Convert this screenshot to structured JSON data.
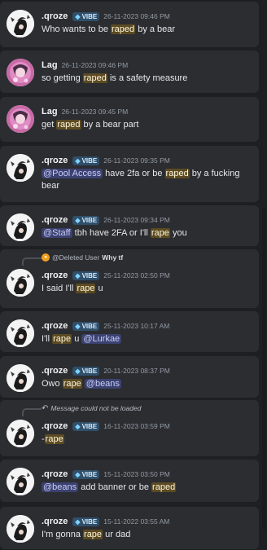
{
  "results": [
    {
      "user": "qroze",
      "user_display": ".qroze",
      "badge": "VIBE",
      "time": "26-11-2023 09:46 PM",
      "parts": [
        {
          "t": "Who wants to be "
        },
        {
          "t": "raped",
          "hl": true
        },
        {
          "t": " by a bear"
        }
      ]
    },
    {
      "user": "lag",
      "user_display": "Lag",
      "badge": "",
      "time": "26-11-2023 09:46 PM",
      "parts": [
        {
          "t": "so getting "
        },
        {
          "t": "raped",
          "hl": true
        },
        {
          "t": " is a safety measure"
        }
      ]
    },
    {
      "user": "lag",
      "user_display": "Lag",
      "badge": "",
      "time": "26-11-2023 09:45 PM",
      "parts": [
        {
          "t": "get "
        },
        {
          "t": "raped",
          "hl": true
        },
        {
          "t": " by a bear part"
        }
      ]
    },
    {
      "user": "qroze",
      "user_display": ".qroze",
      "badge": "VIBE",
      "time": "26-11-2023 09:35 PM",
      "parts": [
        {
          "t": "@Pool Access",
          "mention": true
        },
        {
          "t": " have 2fa or be "
        },
        {
          "t": "raped",
          "hl": true
        },
        {
          "t": " by a fucking bear"
        }
      ]
    },
    {
      "user": "qroze",
      "user_display": ".qroze",
      "badge": "VIBE",
      "time": "26-11-2023 09:34 PM",
      "parts": [
        {
          "t": "@Staff",
          "mention": true
        },
        {
          "t": " tbh have 2FA or I'll "
        },
        {
          "t": "rape",
          "hl": true
        },
        {
          "t": " you"
        }
      ]
    },
    {
      "user": "qroze",
      "user_display": ".qroze",
      "badge": "VIBE",
      "time": "25-11-2023 02:50 PM",
      "reply": {
        "author": "@Deleted User",
        "text": "Why tf"
      },
      "parts": [
        {
          "t": "I said I'll "
        },
        {
          "t": "rape",
          "hl": true
        },
        {
          "t": " u"
        }
      ]
    },
    {
      "user": "qroze",
      "user_display": ".qroze",
      "badge": "VIBE",
      "time": "25-11-2023 10:17 AM",
      "parts": [
        {
          "t": "I'll "
        },
        {
          "t": "rape",
          "hl": true
        },
        {
          "t": " u "
        },
        {
          "t": "@Lurkae",
          "mention": true
        }
      ]
    },
    {
      "user": "qroze",
      "user_display": ".qroze",
      "badge": "VIBE",
      "time": "20-11-2023 08:37 PM",
      "parts": [
        {
          "t": "Owo "
        },
        {
          "t": "rape",
          "hl": true
        },
        {
          "t": " "
        },
        {
          "t": "@beans",
          "mention": true
        }
      ]
    },
    {
      "user": "qroze",
      "user_display": ".qroze",
      "badge": "VIBE",
      "time": "16-11-2023 03:59 PM",
      "reply": {
        "text": "Message could not be loaded",
        "missing": true
      },
      "parts": [
        {
          "t": "-"
        },
        {
          "t": "rape",
          "hl": true
        }
      ]
    },
    {
      "user": "qroze",
      "user_display": ".qroze",
      "badge": "VIBE",
      "time": "15-11-2023 03:50 PM",
      "parts": [
        {
          "t": "@beans",
          "mention": true
        },
        {
          "t": " add banner or be "
        },
        {
          "t": "raped",
          "hl": true
        }
      ]
    },
    {
      "user": "qroze",
      "user_display": ".qroze",
      "badge": "VIBE",
      "time": "15-11-2022 03:55 AM",
      "parts": [
        {
          "t": "I'm gonna "
        },
        {
          "t": "rape",
          "hl": true
        },
        {
          "t": " ur dad"
        }
      ]
    }
  ]
}
